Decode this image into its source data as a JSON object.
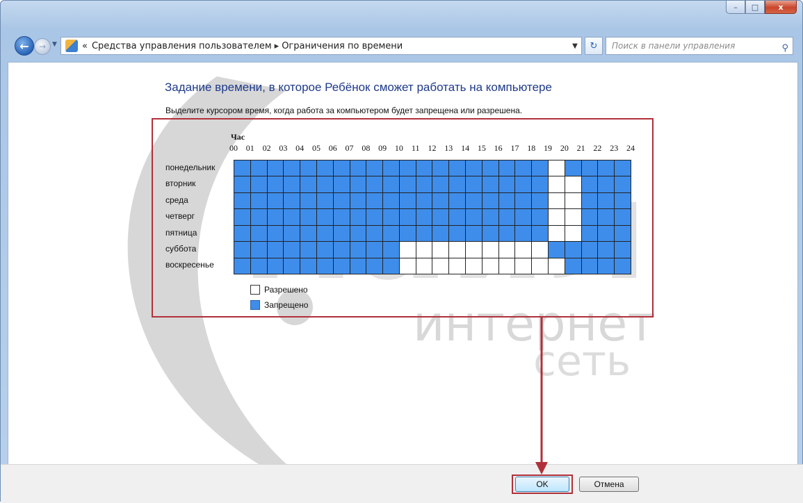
{
  "window": {
    "controls": {
      "minimize": "–",
      "maximize": "□",
      "close": "x"
    }
  },
  "navigation": {
    "back_icon": "back-arrow-icon",
    "forward_icon": "forward-arrow-icon",
    "breadcrumb_prefix": "«",
    "breadcrumbs": [
      "Средства управления пользователем",
      "Ограничения по времени"
    ],
    "separator": "▸",
    "search_placeholder": "Поиск в панели управления"
  },
  "page": {
    "title": "Задание времени, в которое Ребёнок сможет работать на компьютере",
    "instruction": "Выделите курсором время, когда работа за компьютером будет запрещена или разрешена."
  },
  "schedule": {
    "hour_heading": "Час",
    "hours": [
      "00",
      "01",
      "02",
      "03",
      "04",
      "05",
      "06",
      "07",
      "08",
      "09",
      "10",
      "11",
      "12",
      "13",
      "14",
      "15",
      "16",
      "17",
      "18",
      "19",
      "20",
      "21",
      "22",
      "23",
      "24"
    ],
    "days": [
      "понедельник",
      "вторник",
      "среда",
      "четверг",
      "пятница",
      "суббота",
      "воскресенье"
    ],
    "allowed_ranges": [
      [
        [
          19,
          20
        ]
      ],
      [
        [
          19,
          21
        ]
      ],
      [
        [
          19,
          21
        ]
      ],
      [
        [
          19,
          21
        ]
      ],
      [
        [
          19,
          21
        ]
      ],
      [
        [
          10,
          19
        ]
      ],
      [
        [
          10,
          20
        ]
      ]
    ],
    "colors": {
      "blocked": "#3e8deb",
      "allowed": "#ffffff"
    }
  },
  "legend": {
    "allowed": "Разрешено",
    "blocked": "Запрещено"
  },
  "footer": {
    "ok": "OK",
    "cancel": "Отмена"
  },
  "watermark": {
    "brand": "майл",
    "line1": "интернет",
    "line2": "сеть"
  }
}
